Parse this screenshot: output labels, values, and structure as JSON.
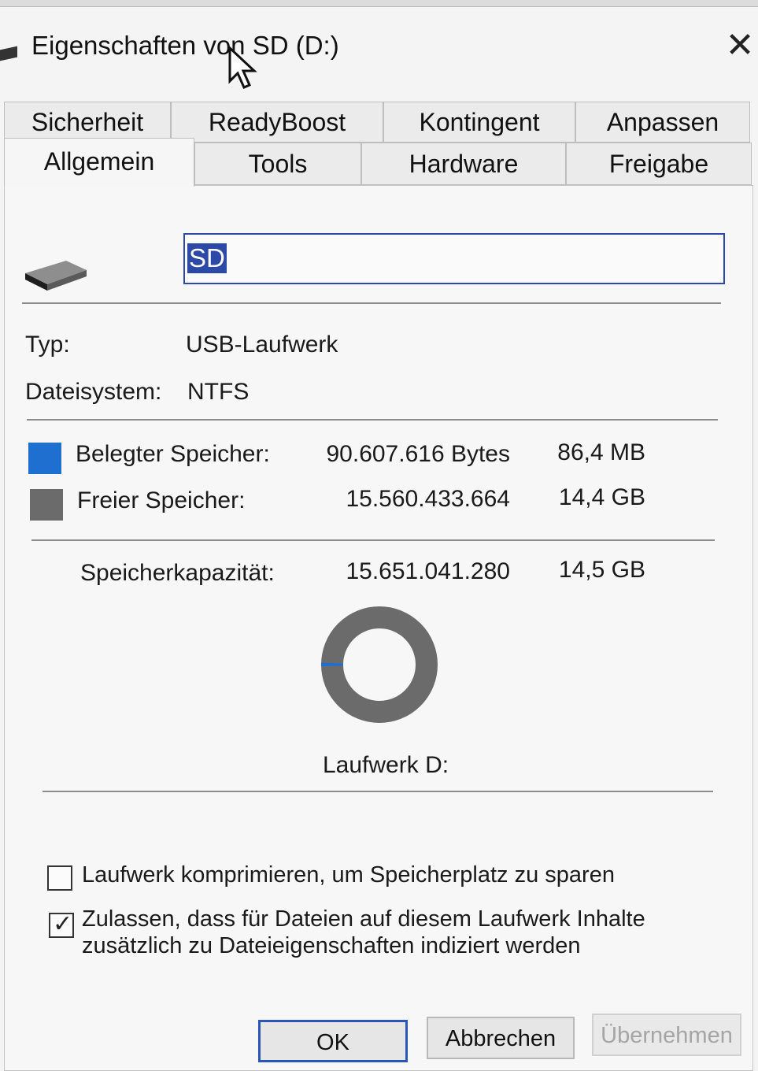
{
  "window": {
    "title": "Eigenschaften von SD (D:)",
    "close_glyph": "✕"
  },
  "tabs_row1": [
    {
      "label": "Sicherheit"
    },
    {
      "label": "ReadyBoost"
    },
    {
      "label": "Kontingent"
    },
    {
      "label": "Anpassen"
    }
  ],
  "tabs_row2": [
    {
      "label": "Allgemein",
      "active": true
    },
    {
      "label": "Tools"
    },
    {
      "label": "Hardware"
    },
    {
      "label": "Freigabe"
    }
  ],
  "general": {
    "name_value": "SD",
    "type_label": "Typ:",
    "type_value": "USB-Laufwerk",
    "fs_label": "Dateisystem:",
    "fs_value": "NTFS",
    "used_label": "Belegter Speicher:",
    "used_bytes": "90.607.616 Bytes",
    "used_size": "86,4 MB",
    "free_label": "Freier Speicher:",
    "free_bytes": "15.560.433.664",
    "free_size": "14,4 GB",
    "capacity_label": "Speicherkapazität:",
    "capacity_bytes": "15.651.041.280",
    "capacity_size": "14,5 GB",
    "drive_label": "Laufwerk D:",
    "used_fraction": 0.0058
  },
  "colors": {
    "used": "#1e6fd0",
    "free": "#6b6b6b",
    "accent": "#2c49a8"
  },
  "options": {
    "compress_label": "Laufwerk komprimieren, um Speicherplatz zu sparen",
    "compress_checked": false,
    "index_label_line1": "Zulassen, dass für Dateien auf diesem Laufwerk Inhalte",
    "index_label_line2": "zusätzlich zu Dateieigenschaften indiziert werden",
    "index_checked": true
  },
  "buttons": {
    "ok": "OK",
    "cancel": "Abbrechen",
    "apply": "Übernehmen"
  },
  "icons": {
    "drive": "usb-drive-icon",
    "close": "close-icon",
    "cursor": "mouse-cursor-icon",
    "check": "checkmark-icon"
  }
}
